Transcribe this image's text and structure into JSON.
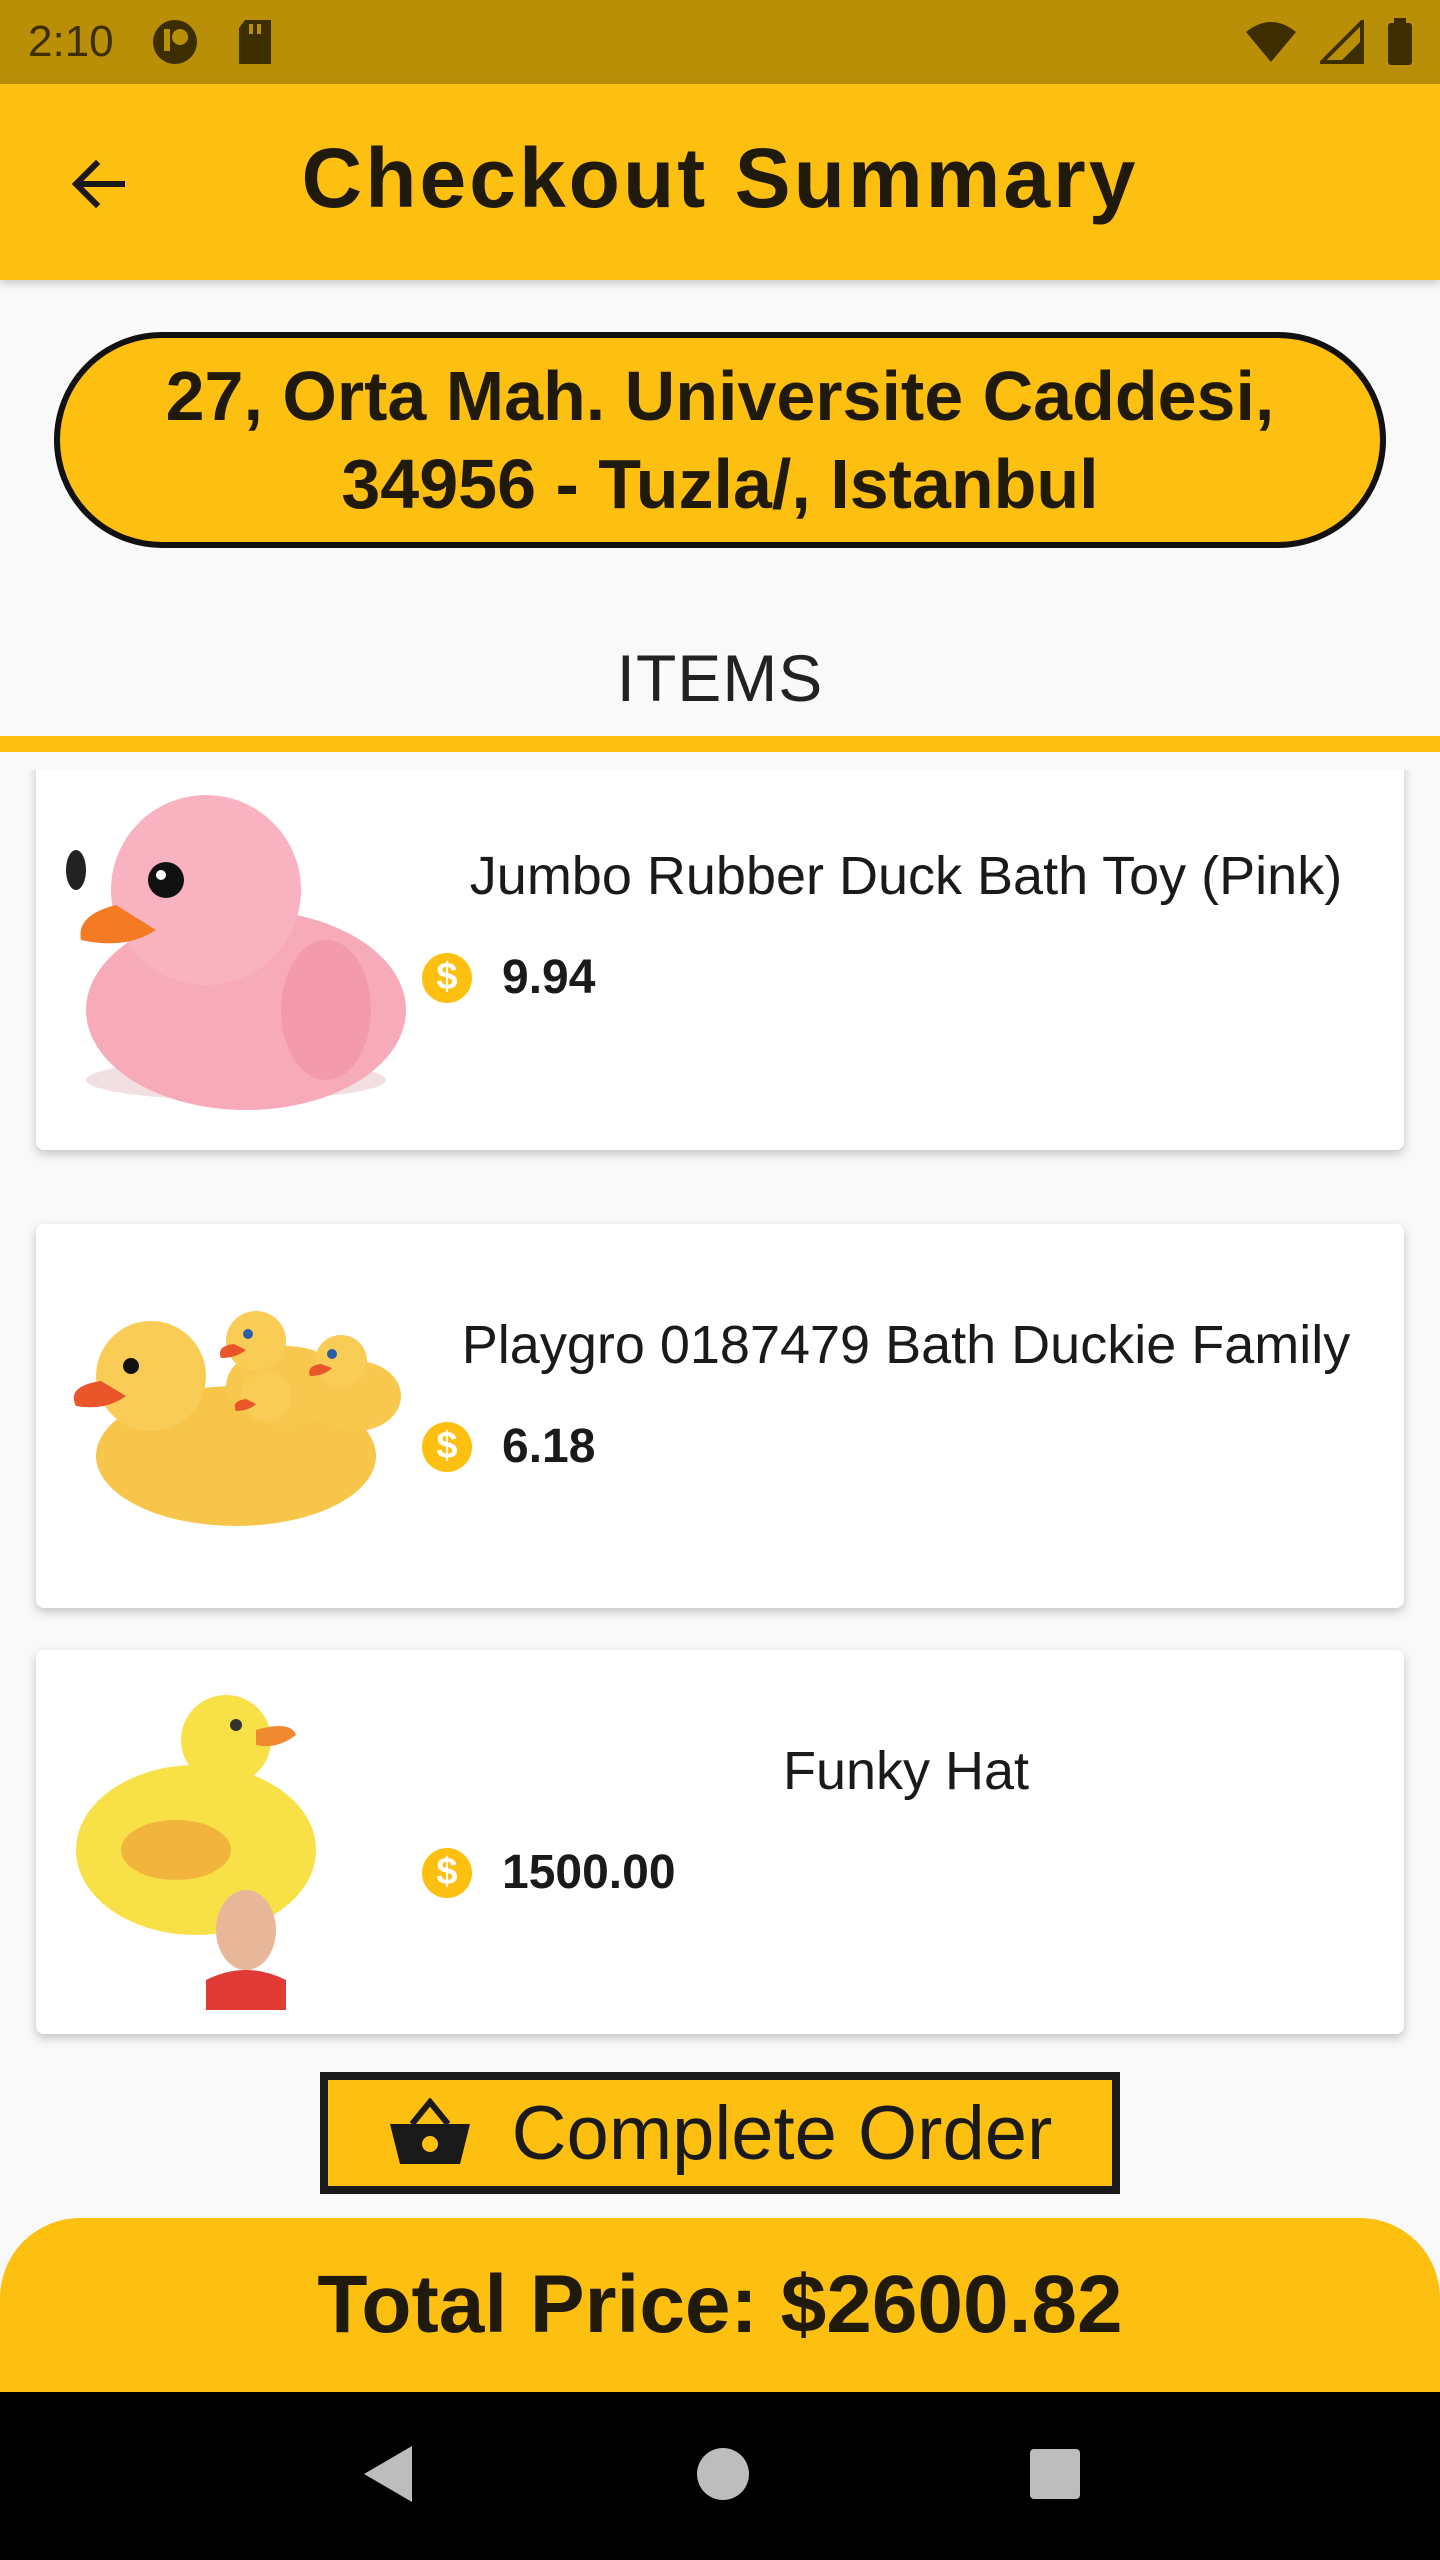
{
  "status_bar": {
    "time": "2:10"
  },
  "app_bar": {
    "title": "Checkout Summary"
  },
  "address": {
    "line1": "27, Orta Mah. Universite Caddesi,",
    "line2": "34956 - Tuzla/, Istanbul"
  },
  "tab": {
    "label": "ITEMS"
  },
  "items": [
    {
      "name": "Jumbo Rubber Duck Bath Toy (Pink)",
      "price": "9.94",
      "image_icon": "pink-duck-image"
    },
    {
      "name": "Playgro 0187479 Bath Duckie Family",
      "price": "6.18",
      "image_icon": "duck-family-image"
    },
    {
      "name": "Funky Hat",
      "price": "1500.00",
      "image_icon": "duck-hat-image"
    }
  ],
  "currency_symbol": "$",
  "actions": {
    "complete_order": "Complete Order"
  },
  "total": {
    "label": "Total Price: $2600.82"
  },
  "colors": {
    "accent": "#fdbf10",
    "status_bar": "#b98f08"
  }
}
